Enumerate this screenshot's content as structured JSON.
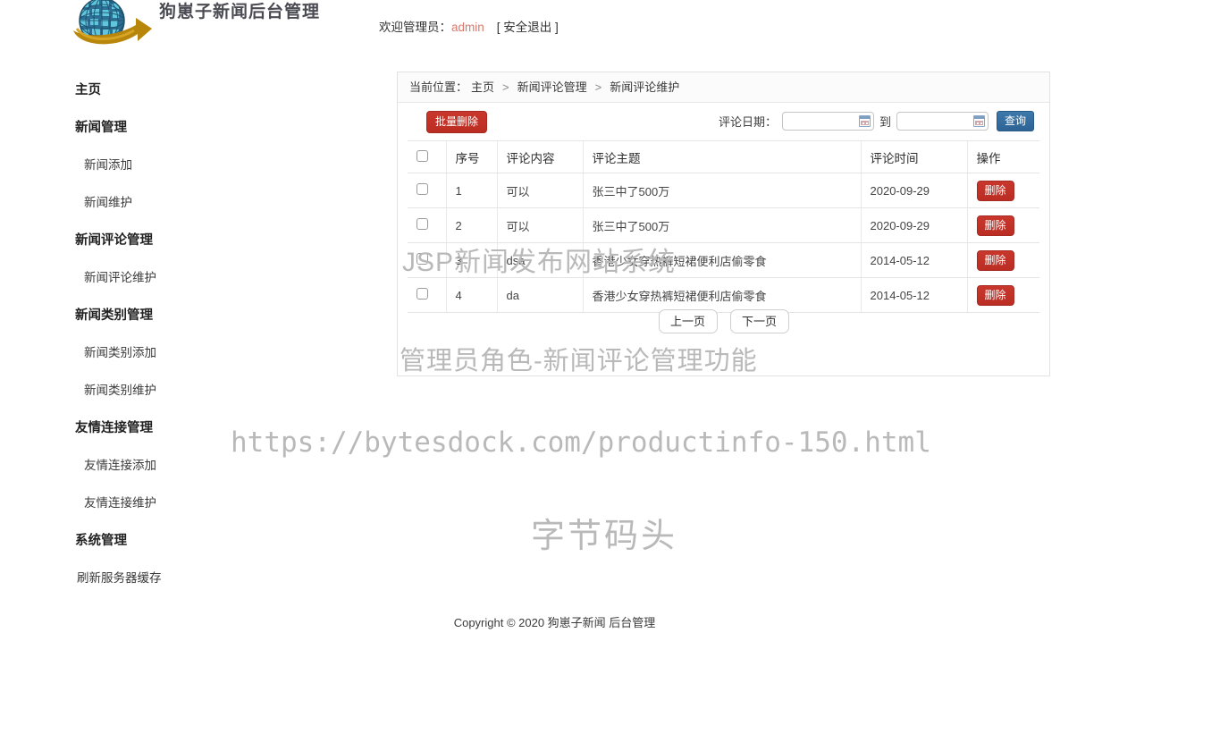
{
  "header": {
    "logo_icon": "globe-arrow-logo",
    "logo_text": "狗崽子新闻后台管理",
    "welcome_prefix": "欢迎管理员：",
    "username": "admin",
    "logout_label": "[ 安全退出 ]"
  },
  "sidebar": {
    "items": [
      {
        "label": "主页",
        "type": "group"
      },
      {
        "label": "新闻管理",
        "type": "group"
      },
      {
        "label": "新闻添加",
        "type": "item"
      },
      {
        "label": "新闻维护",
        "type": "item"
      },
      {
        "label": "新闻评论管理",
        "type": "group"
      },
      {
        "label": "新闻评论维护",
        "type": "item"
      },
      {
        "label": "新闻类别管理",
        "type": "group"
      },
      {
        "label": "新闻类别添加",
        "type": "item"
      },
      {
        "label": "新闻类别维护",
        "type": "item"
      },
      {
        "label": "友情连接管理",
        "type": "group"
      },
      {
        "label": "友情连接添加",
        "type": "item"
      },
      {
        "label": "友情连接维护",
        "type": "item"
      },
      {
        "label": "系统管理",
        "type": "group"
      },
      {
        "label": "刷新服务器缓存",
        "type": "item"
      }
    ]
  },
  "breadcrumb": {
    "label": "当前位置：",
    "home": "主页",
    "sep": ">",
    "level2": "新闻评论管理",
    "level3": "新闻评论维护"
  },
  "toolbar": {
    "bulk_delete_label": "批量删除",
    "date_label": "评论日期：",
    "date_from_value": "",
    "date_from_placeholder": "",
    "to_label": "到",
    "date_to_value": "",
    "date_to_placeholder": "",
    "query_label": "查询",
    "calendar_icon": "calendar-icon"
  },
  "table": {
    "columns": [
      "",
      "序号",
      "评论内容",
      "评论主题",
      "评论时间",
      "操作"
    ],
    "rows": [
      {
        "no": "1",
        "content": "可以",
        "topic": "张三中了500万",
        "time": "2020-09-29",
        "action": "删除"
      },
      {
        "no": "2",
        "content": "可以",
        "topic": "张三中了500万",
        "time": "2020-09-29",
        "action": "删除"
      },
      {
        "no": "3",
        "content": "dsa",
        "topic": "香港少女穿热裤短裙便利店偷零食",
        "time": "2014-05-12",
        "action": "删除"
      },
      {
        "no": "4",
        "content": "da",
        "topic": "香港少女穿热裤短裙便利店偷零食",
        "time": "2014-05-12",
        "action": "删除"
      }
    ]
  },
  "pager": {
    "prev_label": "上一页",
    "next_label": "下一页"
  },
  "watermarks": {
    "system": "JSP新闻发布网站系统",
    "role": "管理员角色-新闻评论管理功能",
    "url": "https://bytesdock.com/productinfo-150.html",
    "brand": "字节码头"
  },
  "footer": {
    "text": "Copyright © 2020 狗崽子新闻 后台管理"
  },
  "colors": {
    "danger": "#bb2d23",
    "primary": "#2d6494",
    "username": "#d9796c",
    "watermark": "#b9b9b9"
  }
}
